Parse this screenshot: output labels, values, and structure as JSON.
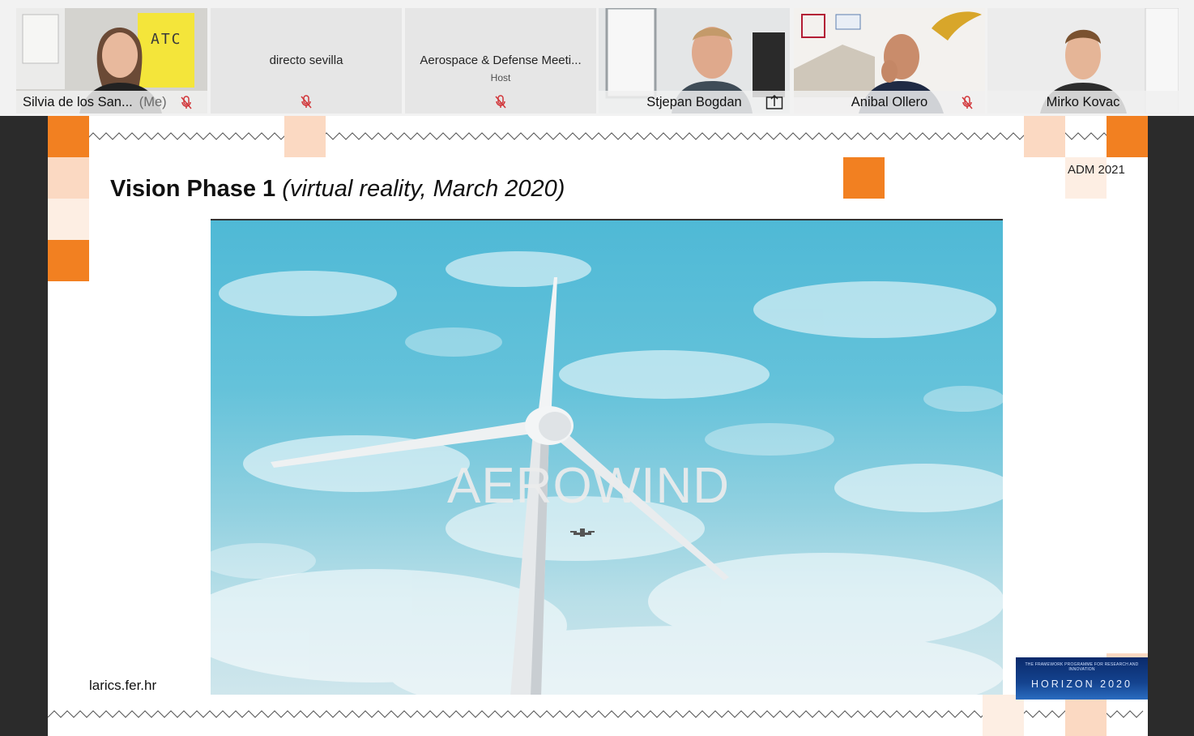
{
  "participants": [
    {
      "name": "Silvia de los San...",
      "me_label": "(Me)",
      "muted": true
    },
    {
      "name": "directo sevilla",
      "muted": true
    },
    {
      "name": "Aerospace & Defense Meeti...",
      "role": "Host",
      "muted": true
    },
    {
      "name": "Stjepan Bogdan",
      "muted": false,
      "sharing": true,
      "active": true
    },
    {
      "name": "Anibal Ollero",
      "muted": true
    },
    {
      "name": "Mirko Kovac",
      "muted": false
    }
  ],
  "tile_text": {
    "silvia_poster": "ATC"
  },
  "slide": {
    "title_bold": "Vision Phase 1",
    "title_italic": "(virtual reality, March 2020)",
    "conference_tag": "ADM 2021",
    "website": "larics.fer.hr",
    "video_caption": "AEROWIND",
    "logo_tagline": "THE FRAMEWORK PROGRAMME FOR RESEARCH AND INNOVATION",
    "logo_word": "HORIZON 2020"
  },
  "colors": {
    "active_speaker": "#1fb1e6",
    "mute_red": "#d13438",
    "accent_orange": "#f28021",
    "accent_peach": "#fbd9c2",
    "accent_pale": "#fdeee3",
    "sky_blue": "#5dbfd8"
  }
}
